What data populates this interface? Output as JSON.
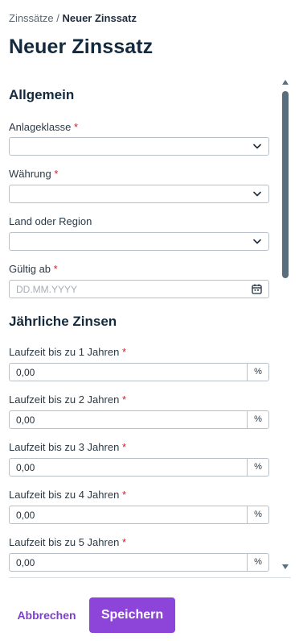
{
  "breadcrumb": {
    "parent": "Zinssätze",
    "separator": "/",
    "current": "Neuer Zinssatz"
  },
  "page_title": "Neuer Zinssatz",
  "required_marker": "*",
  "section_general": {
    "title": "Allgemein",
    "asset_class": {
      "label": "Anlageklasse",
      "value": ""
    },
    "currency": {
      "label": "Währung",
      "value": ""
    },
    "country": {
      "label": "Land oder Region",
      "value": ""
    },
    "valid_from": {
      "label": "Gültig ab",
      "placeholder": "DD.MM.YYYY",
      "value": ""
    }
  },
  "section_rates": {
    "title": "Jährliche Zinsen",
    "unit": "%",
    "terms": [
      {
        "label": "Laufzeit bis zu 1 Jahren",
        "value": "0,00"
      },
      {
        "label": "Laufzeit bis zu 2 Jahren",
        "value": "0,00"
      },
      {
        "label": "Laufzeit bis zu 3 Jahren",
        "value": "0,00"
      },
      {
        "label": "Laufzeit bis zu 4 Jahren",
        "value": "0,00"
      },
      {
        "label": "Laufzeit bis zu 5 Jahren",
        "value": "0,00"
      }
    ]
  },
  "footer": {
    "cancel_label": "Abbrechen",
    "save_label": "Speichern"
  },
  "icons": {
    "select": "chevron-down-icon",
    "date": "calendar-icon"
  },
  "colors": {
    "accent": "#8c45d8",
    "required": "#c8202f",
    "title": "#13293d",
    "scroll_thumb": "#5a6f7e"
  }
}
